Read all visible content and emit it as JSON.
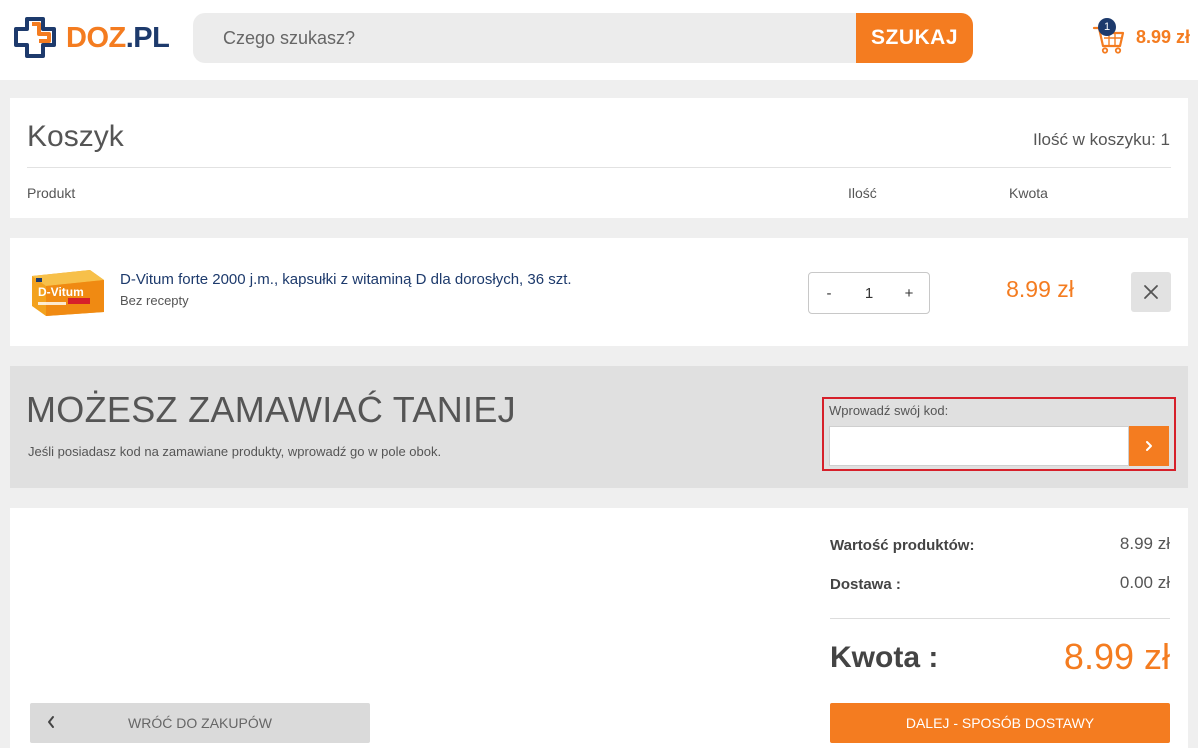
{
  "header": {
    "logo": {
      "part1": "DOZ",
      "part2": ".PL"
    },
    "search": {
      "placeholder": "Czego szukasz?",
      "button_label": "SZUKAJ"
    },
    "cart": {
      "badge_count": "1",
      "total": "8.99 zł"
    }
  },
  "cart_header": {
    "title": "Koszyk",
    "count_label": "Ilość w koszyku: 1",
    "columns": {
      "product": "Produkt",
      "quantity": "Ilość",
      "amount": "Kwota"
    }
  },
  "items": [
    {
      "name": "D-Vitum forte 2000 j.m., kapsułki z witaminą D dla dorosłych, 36 szt.",
      "subtitle": "Bez recepty",
      "quantity": "1",
      "minus": "-",
      "plus": "+",
      "price": "8.99 zł",
      "box_text": "D-Vitum"
    }
  ],
  "promo": {
    "heading": "MOŻESZ ZAMAWIAĆ TANIEJ",
    "description": "Jeśli posiadasz kod na zamawiane produkty, wprowadź go w pole obok.",
    "code_label": "Wprowadź swój kod:",
    "code_value": ""
  },
  "summary": {
    "products_label": "Wartość produktów:",
    "products_value": "8.99 zł",
    "delivery_label": "Dostawa :",
    "delivery_value": "0.00 zł",
    "total_label": "Kwota :",
    "total_value": "8.99 zł"
  },
  "actions": {
    "back_label": "WRÓĆ DO ZAKUPÓW",
    "next_label": "DALEJ - SPOSÓB DOSTAWY"
  },
  "colors": {
    "accent": "#f47c20",
    "brand_dark": "#1d3a6c",
    "highlight": "#d6202a"
  }
}
